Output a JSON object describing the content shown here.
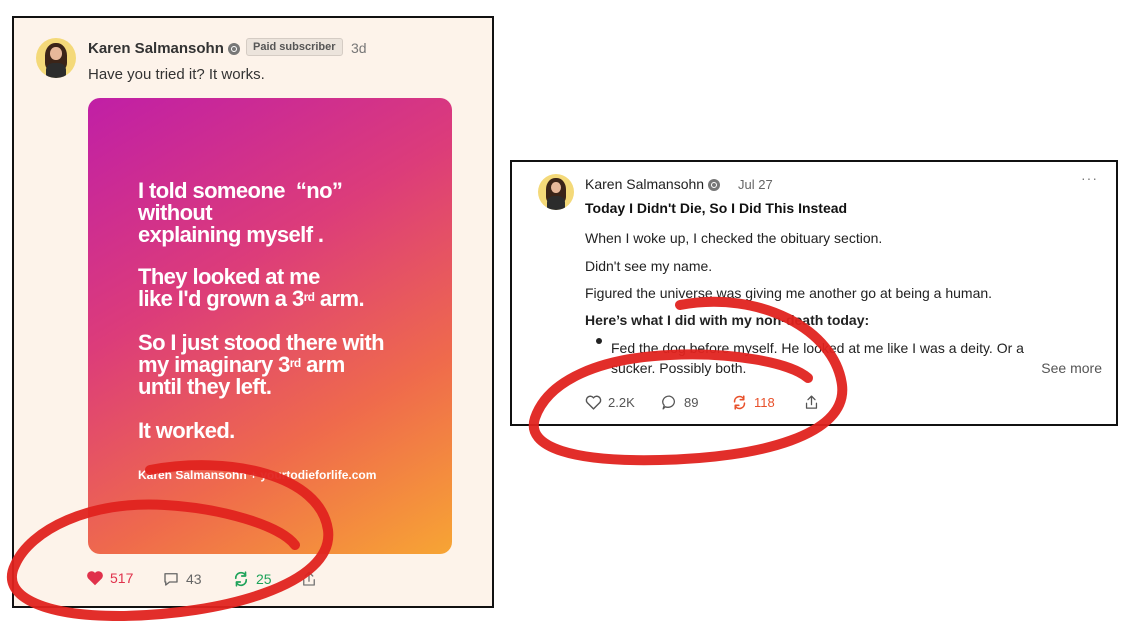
{
  "post1": {
    "author": "Karen Salmansohn",
    "badge": "Paid subscriber",
    "time": "3d",
    "text": "Have you tried it? It works.",
    "image_lines": {
      "l1": "I told someone  “no”",
      "l2": "without",
      "l3": "explaining myself .",
      "l4": "They looked at me",
      "l5a": "like I'd grown a 3",
      "l5sup": "rd",
      "l5b": " arm.",
      "l6": "So I just stood there with",
      "l7a": "my imaginary 3",
      "l7sup": "rd",
      "l7b": " arm",
      "l8": "until they left.",
      "l9": "It worked.",
      "footer": "Karen Salmansohn + yourtodieforlife.com"
    },
    "actions": {
      "likes": "517",
      "comments": "43",
      "restacks": "25"
    },
    "colors": {
      "like": "#e0314b",
      "restack": "#1fa35a",
      "gradient_start": "#c01fa6",
      "gradient_end": "#f7a534"
    }
  },
  "post2": {
    "author": "Karen Salmansohn",
    "time": "Jul 27",
    "more": "···",
    "title": "Today I Didn't Die, So I Did This Instead",
    "paragraphs": [
      "When I woke up, I checked the obituary section.",
      "Didn't see my name.",
      "Figured the universe was giving me another go at being a human."
    ],
    "subheading": "Here’s what I did with my non-death today:",
    "bullet_line1": "Fed the dog before myself. He looked at me like I was a deity. Or a",
    "bullet_line2": "sucker. Possibly both.",
    "see_more": "See more",
    "actions": {
      "likes": "2.2K",
      "comments": "89",
      "restacks": "118"
    },
    "colors": {
      "restack": "#e8502a",
      "annotation": "#e0231f"
    }
  },
  "icons": [
    "verified-icon",
    "heart-icon",
    "comment-icon",
    "restack-icon",
    "share-icon"
  ]
}
